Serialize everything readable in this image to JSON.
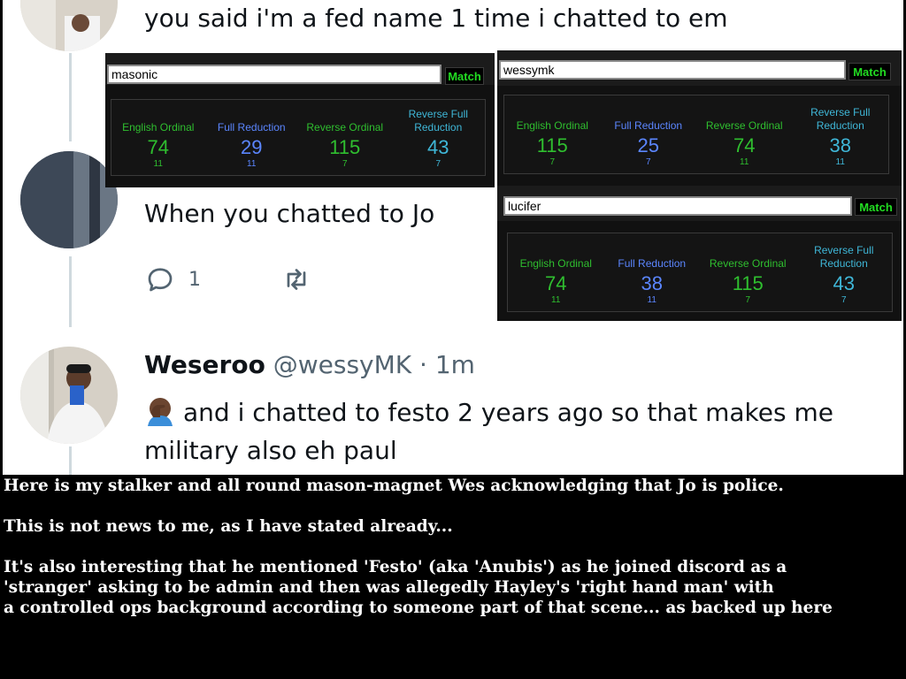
{
  "tweets": {
    "top_text": "you said i'm a fed name 1 time i chatted to em",
    "middle_text": "When you chatted to Jo",
    "reply_count": "1",
    "bottom": {
      "author_name": "Weseroo",
      "author_handle": "@wessyMK",
      "separator": "·",
      "time": "1m",
      "text_line1": "and i chatted to festo 2 years ago so that makes me",
      "text_line2": "military also eh paul",
      "emoji": "facepalm-icon"
    }
  },
  "calculators": [
    {
      "input": "masonic",
      "match_label": "Match",
      "results": [
        {
          "label": "English Ordinal",
          "value": "74",
          "sub": "11"
        },
        {
          "label": "Full Reduction",
          "value": "29",
          "sub": "11"
        },
        {
          "label": "Reverse Ordinal",
          "value": "115",
          "sub": "7"
        },
        {
          "label": "Reverse Full Reduction",
          "value": "43",
          "sub": "7"
        }
      ]
    },
    {
      "input": "wessymk",
      "match_label": "Match",
      "results": [
        {
          "label": "English Ordinal",
          "value": "115",
          "sub": "7"
        },
        {
          "label": "Full Reduction",
          "value": "25",
          "sub": "7"
        },
        {
          "label": "Reverse Ordinal",
          "value": "74",
          "sub": "11"
        },
        {
          "label": "Reverse Full Reduction",
          "value": "38",
          "sub": "11"
        }
      ]
    },
    {
      "input": "lucifer",
      "match_label": "Match",
      "results": [
        {
          "label": "English Ordinal",
          "value": "74",
          "sub": "11"
        },
        {
          "label": "Full Reduction",
          "value": "38",
          "sub": "11"
        },
        {
          "label": "Reverse Ordinal",
          "value": "115",
          "sub": "7"
        },
        {
          "label": "Reverse Full Reduction",
          "value": "43",
          "sub": "7"
        }
      ]
    }
  ],
  "caption": {
    "p1": "Here is my stalker and all round mason-magnet Wes acknowledging that Jo is police.",
    "p2": "This is not news to me, as I have stated already...",
    "p3_line1": "It's also interesting that he mentioned 'Festo' (aka 'Anubis') as he joined discord as a",
    "p3_line2": "'stranger' asking to be admin and then was allegedly Hayley's 'right hand man' with",
    "p3_line3": "a controlled ops background according to someone part of that scene... as backed up here"
  },
  "colors": {
    "english_ordinal": "#2fbf2f",
    "full_reduction": "#5b86ff",
    "reverse_ordinal": "#2fbf2f",
    "reverse_full_reduction": "#3fb7d8",
    "match_text": "#22dd22",
    "caption_bg": "#000000",
    "tweet_bg": "#ffffff"
  }
}
